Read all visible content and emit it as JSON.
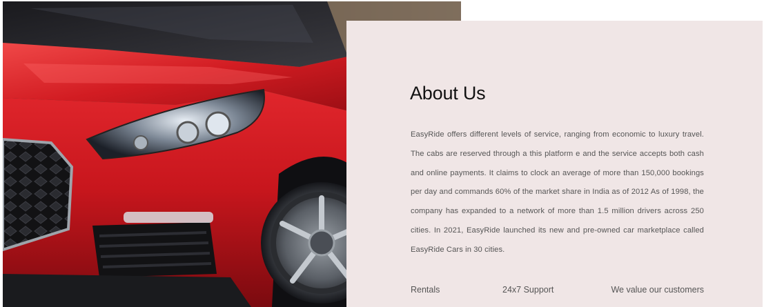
{
  "hero": {
    "image_description_icon": "car-photo",
    "car_color": "#c8161d"
  },
  "about": {
    "title": "About Us",
    "body": "EasyRide offers different levels of service, ranging from economic to luxury travel. The cabs are reserved through a this platform e and the service accepts both cash and online payments. It claims to clock an average of more than 150,000 bookings per day and commands 60% of the market share in India as of 2012 As of 1998, the company has expanded to a network of more than 1.5 million drivers across 250 cities. In 2021, EasyRide launched its new and pre-owned car marketplace called EasyRide Cars in 30 cities.",
    "features": [
      {
        "label": "Rentals"
      },
      {
        "label": "24x7 Support"
      },
      {
        "label": "We value our customers"
      }
    ],
    "background": "#f0e6e6"
  }
}
